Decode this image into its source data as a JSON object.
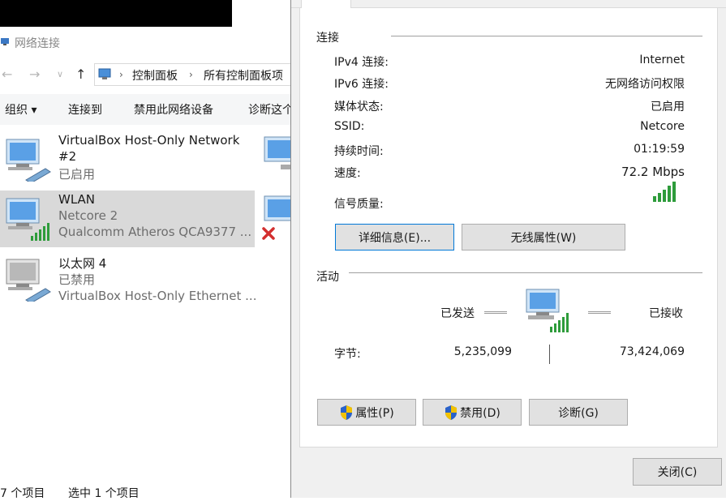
{
  "explorer": {
    "window_title": "网络连接",
    "breadcrumb": [
      "控制面板",
      "所有控制面板项"
    ],
    "commands": [
      "组织 ▾",
      "连接到",
      "禁用此网络设备",
      "诊断这个"
    ],
    "items": [
      {
        "name": "VirtualBox Host-Only Network",
        "name2": "#2",
        "status": "已启用"
      },
      {
        "name": "WLAN",
        "status": "Netcore 2",
        "device": "Qualcomm Atheros QCA9377 ..."
      },
      {
        "name": "以太网 4",
        "status": "已禁用",
        "device": "VirtualBox Host-Only Ethernet ..."
      }
    ],
    "status_bar": {
      "count": "7 个项目",
      "selected": "选中 1 个项目"
    }
  },
  "dialog": {
    "connection_group": "连接",
    "rows": [
      {
        "label": "IPv4 连接:",
        "value": "Internet"
      },
      {
        "label": "IPv6 连接:",
        "value": "无网络访问权限"
      },
      {
        "label": "媒体状态:",
        "value": "已启用"
      },
      {
        "label": "SSID:",
        "value": "Netcore"
      },
      {
        "label": "持续时间:",
        "value": "01:19:59"
      },
      {
        "label": "速度:",
        "value": "72.2 Mbps"
      }
    ],
    "signal_label": "信号质量:",
    "details_button": "详细信息(E)...",
    "wireless_props_button": "无线属性(W)",
    "activity_group": "活动",
    "sent_label": "已发送",
    "received_label": "已接收",
    "bytes_label": "字节:",
    "bytes_sent": "5,235,099",
    "bytes_received": "73,424,069",
    "properties_button": "属性(P)",
    "disable_button": "禁用(D)",
    "diagnose_button": "诊断(G)",
    "close_button": "关闭(C)"
  },
  "colors": {
    "accent_focus": "#0078d7",
    "signal_green": "#2e9c3b",
    "selection_gray": "#d9d9d9",
    "disconnected_red": "#d32f2f"
  }
}
